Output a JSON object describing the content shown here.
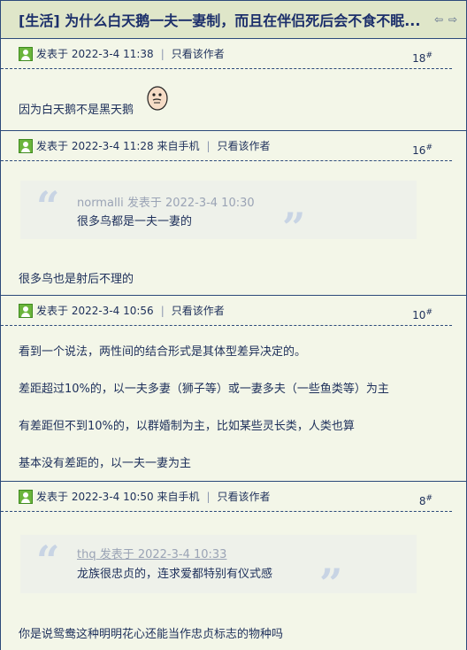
{
  "thread": {
    "title": "[生活] 为什么白天鹅一夫一妻制，而且在伴侣死后会不食不眠..."
  },
  "posts": [
    {
      "meta": "发表于 2022-3-4 11:38",
      "only_author": "只看该作者",
      "floor": "18",
      "floor_suffix": "#",
      "lines": [
        "因为白天鹅不是黑天鹅"
      ]
    },
    {
      "meta": "发表于 2022-3-4 11:28 来自手机",
      "only_author": "只看该作者",
      "floor": "16",
      "floor_suffix": "#",
      "quote": {
        "meta": "normalli 发表于 2022-3-4 10:30",
        "text": "很多鸟都是一夫一妻的"
      },
      "lines": [
        "很多鸟也是射后不理的"
      ]
    },
    {
      "meta": "发表于 2022-3-4 10:56",
      "only_author": "只看该作者",
      "floor": "10",
      "floor_suffix": "#",
      "lines": [
        "看到一个说法，两性间的结合形式是其体型差异决定的。",
        "差距超过10%的，以一夫多妻（狮子等）或一妻多夫（一些鱼类等）为主",
        "有差距但不到10%的，以群婚制为主，比如某些灵长类，人类也算",
        "基本没有差距的，以一夫一妻为主"
      ]
    },
    {
      "meta": "发表于 2022-3-4 10:50 来自手机",
      "only_author": "只看该作者",
      "floor": "8",
      "floor_suffix": "#",
      "quote": {
        "meta": "thq 发表于 2022-3-4 10:33",
        "text": "龙族很忠贞的，连求爱都特别有仪式感"
      },
      "lines": [
        "你是说鸳鸯这种明明花心还能当作忠贞标志的物种吗"
      ]
    }
  ]
}
